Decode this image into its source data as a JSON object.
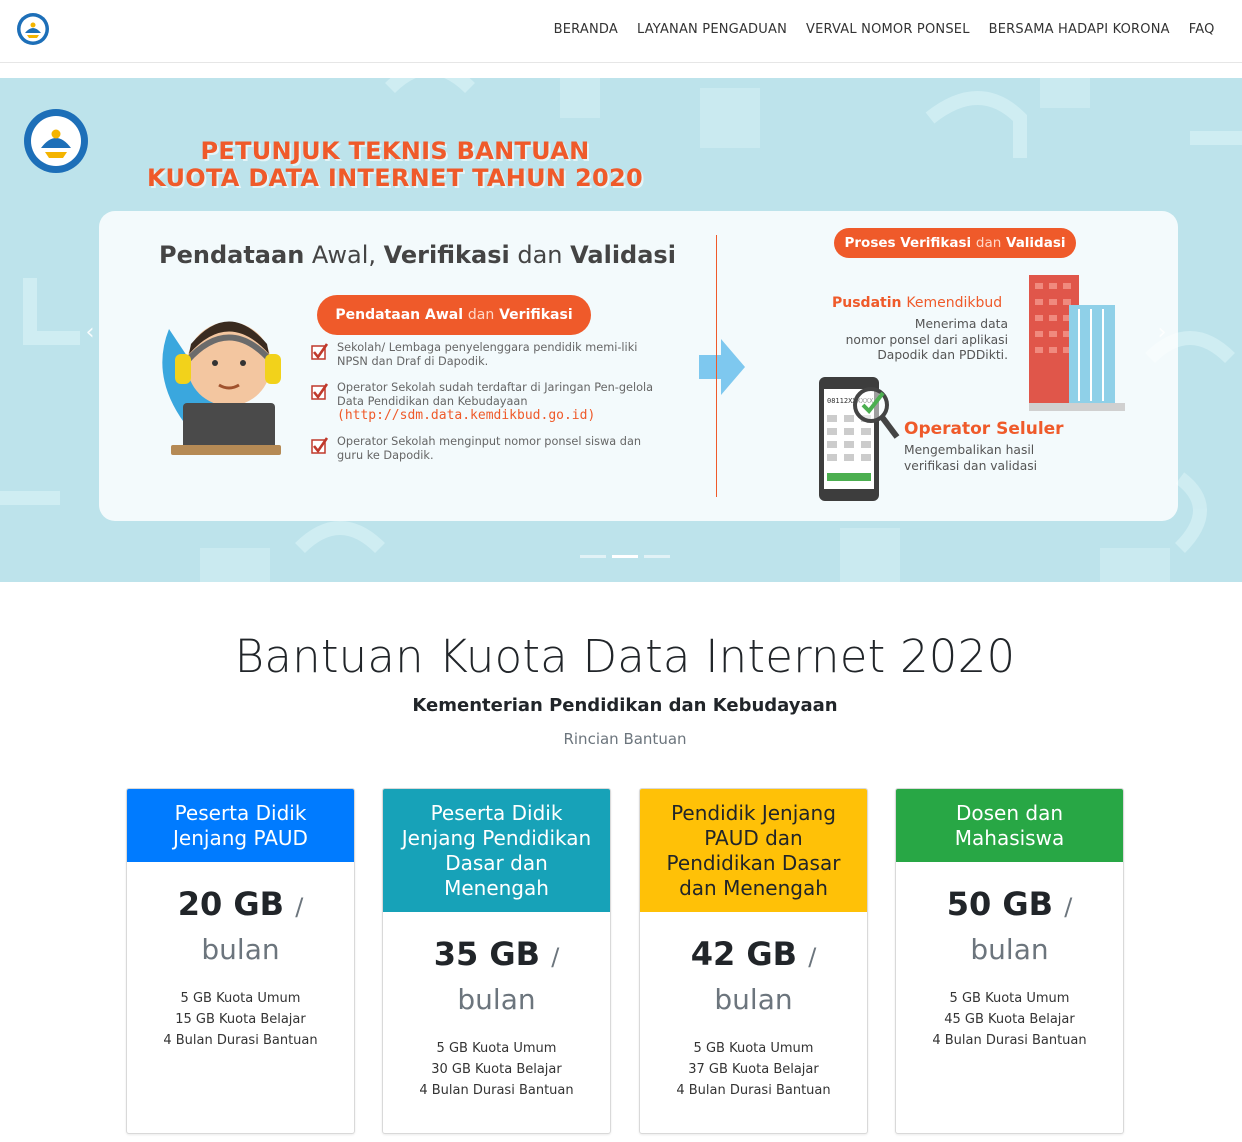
{
  "nav": {
    "logo_icon": "tut-wuri-handayani-logo-icon",
    "items": [
      {
        "label": "BERANDA"
      },
      {
        "label": "LAYANAN PENGADUAN"
      },
      {
        "label": "VERVAL NOMOR PONSEL"
      },
      {
        "label": "BERSAMA HADAPI KORONA"
      },
      {
        "label": "FAQ"
      }
    ]
  },
  "hero": {
    "title_line1": "PETUNJUK TEKNIS BANTUAN",
    "title_line2": "KUOTA DATA INTERNET TAHUN 2020",
    "heading_part1": "Pendataan",
    "heading_part2": "Awal,",
    "heading_part3": "Verifikasi",
    "heading_part4": "dan",
    "heading_part5": "Validasi",
    "pill_left_a": "Pendataan Awal",
    "pill_left_b": "dan",
    "pill_left_c": "Verifikasi",
    "checklist": [
      {
        "text": "Sekolah/ Lembaga penyelenggara pendidik memi-liki NPSN dan Draf di Dapodik."
      },
      {
        "text": "Operator Sekolah sudah terdaftar di Jaringan Pen-gelola Data Pendidikan dan Kebudayaan",
        "url": "(http://sdm.data.kemdikbud.go.id)"
      },
      {
        "text": "Operator Sekolah menginput nomor ponsel siswa dan guru ke Dapodik."
      }
    ],
    "pill_right_a": "Proses Verifikasi",
    "pill_right_b": "dan",
    "pill_right_c": "Validasi",
    "pusdatin_title_a": "Pusdatin",
    "pusdatin_title_b": "Kemendikbud",
    "pusdatin_text": [
      "Menerima data",
      "nomor ponsel dari aplikasi",
      "Dapodik dan PDDikti."
    ],
    "operator_title": "Operator Seluler",
    "operator_text": [
      "Mengembalikan hasil",
      "verifikasi dan validasi"
    ],
    "phone_number": "08112XXXXXX",
    "prev_icon": "chevron-left-icon",
    "next_icon": "chevron-right-icon",
    "slide_count": 3,
    "active_slide": 2
  },
  "main": {
    "title": "Bantuan Kuota Data Internet 2020",
    "subtitle": "Kementerian Pendidikan dan Kebudayaan",
    "muted": "Rincian Bantuan"
  },
  "plans": [
    {
      "header": [
        "Peserta Didik",
        "Jenjang PAUD"
      ],
      "amount": "20 GB",
      "slash": "/",
      "unit": "bulan",
      "features": [
        "5 GB Kuota Umum",
        "15 GB Kuota Belajar",
        "4 Bulan Durasi Bantuan"
      ],
      "color": "#007bff"
    },
    {
      "header": [
        "Peserta Didik",
        "Jenjang Pendidikan",
        "Dasar dan",
        "Menengah"
      ],
      "amount": "35 GB",
      "slash": "/",
      "unit": "bulan",
      "features": [
        "5 GB Kuota Umum",
        "30 GB Kuota Belajar",
        "4 Bulan Durasi Bantuan"
      ],
      "color": "#17a2b8"
    },
    {
      "header": [
        "Pendidik Jenjang",
        "PAUD dan",
        "Pendidikan Dasar",
        "dan Menengah"
      ],
      "amount": "42 GB",
      "slash": "/",
      "unit": "bulan",
      "features": [
        "5 GB Kuota Umum",
        "37 GB Kuota Belajar",
        "4 Bulan Durasi Bantuan"
      ],
      "color": "#ffc107"
    },
    {
      "header": [
        "Dosen dan",
        "Mahasiswa"
      ],
      "amount": "50 GB",
      "slash": "/",
      "unit": "bulan",
      "features": [
        "5 GB Kuota Umum",
        "45 GB Kuota Belajar",
        "4 Bulan Durasi Bantuan"
      ],
      "color": "#28a745"
    }
  ]
}
